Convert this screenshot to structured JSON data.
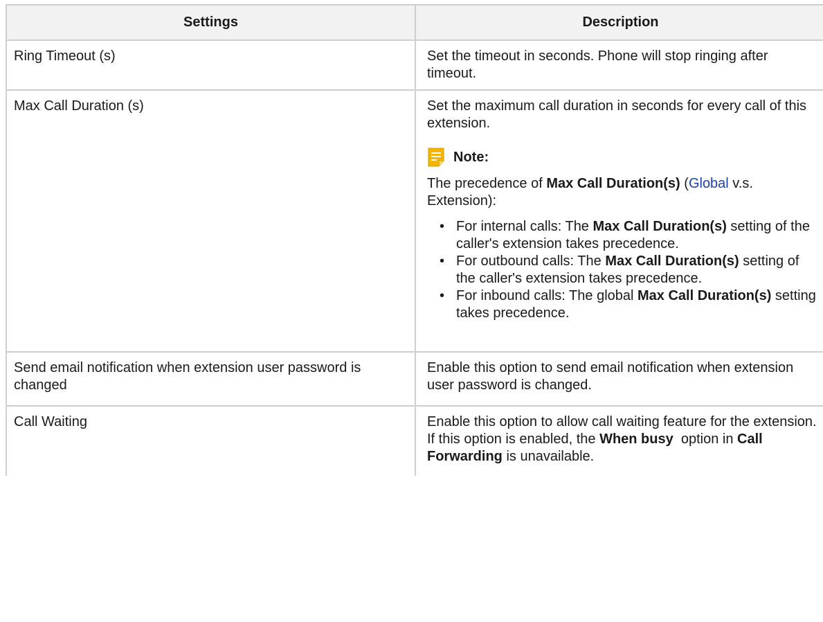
{
  "header": {
    "settings": "Settings",
    "description": "Description"
  },
  "rows": {
    "ring_timeout": {
      "setting": "Ring Timeout (s)",
      "description": "Set the timeout in seconds. Phone will stop ringing after timeout."
    },
    "max_call": {
      "setting": "Max Call Duration (s)",
      "description": "Set the maximum call duration in seconds for every call of this extension.",
      "note": {
        "title": "Note:",
        "intro_prefix": "The precedence of ",
        "intro_bold": "Max Call Duration(s)",
        "intro_open": "(",
        "intro_link": "Global",
        "intro_suffix": " v.s. Extension):",
        "items": [
          {
            "prefix": "For internal calls: The ",
            "bold": "Max Call Duration(s)",
            "suffix": " setting of the caller's extension takes precedence."
          },
          {
            "prefix": "For outbound calls: The ",
            "bold": "Max Call Duration(s)",
            "suffix": " setting of the caller's extension takes precedence."
          },
          {
            "prefix": "For inbound calls: The global ",
            "bold": "Max Call Duration(s)",
            "suffix": " setting takes precedence."
          }
        ]
      }
    },
    "email_notify": {
      "setting": "Send email notification when extension user password is changed",
      "description": "Enable this option to send email notification when extension user password is changed."
    },
    "call_waiting": {
      "setting": "Call Waiting",
      "desc_prefix": "Enable this option to allow call waiting feature for the extension. If this option is enabled, the ",
      "desc_bold1": "When busy",
      "desc_middle": "  option in ",
      "desc_bold2": "Call Forwarding",
      "desc_suffix": " is unavailable."
    }
  },
  "icons": {
    "note": "note-icon"
  },
  "colors": {
    "header_bg": "#f2f2f2",
    "border": "#cfcfcf",
    "link": "#1f3fa8",
    "note_icon": "#f5b400"
  }
}
